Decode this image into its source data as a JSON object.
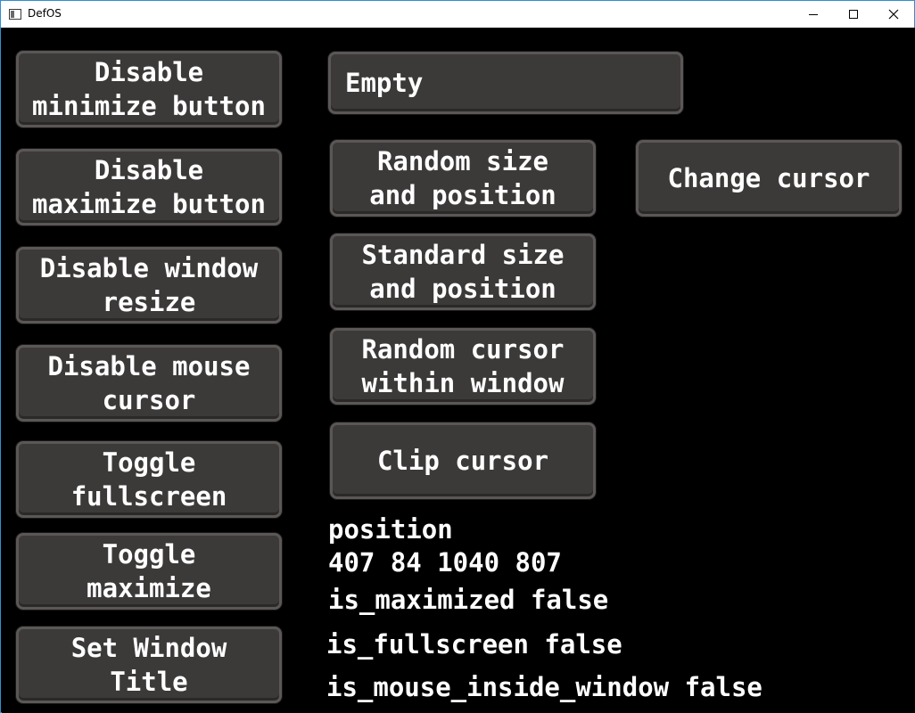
{
  "window": {
    "title": "DefOS",
    "icons": {
      "app": "window-icon",
      "minimize": "minimize-icon",
      "maximize": "maximize-icon",
      "close": "close-icon"
    },
    "colors": {
      "frame": "#2f8fcf",
      "background": "#000000",
      "button_fill": "#3c3a39",
      "button_border": "#5a5756",
      "text": "#ffffff"
    }
  },
  "buttons": {
    "disable_minimize": "Disable\nminimize button",
    "disable_maximize": "Disable\nmaximize button",
    "disable_resize": "Disable window\nresize",
    "disable_mouse_cursor": "Disable mouse\ncursor",
    "toggle_fullscreen": "Toggle\nfullscreen",
    "toggle_maximize": "Toggle\nmaximize",
    "set_window_title": "Set Window\nTitle",
    "empty": "Empty",
    "random_size_position": "Random size\nand position",
    "standard_size_position": "Standard size\nand position",
    "random_cursor": "Random cursor\nwithin window",
    "clip_cursor": "Clip cursor",
    "change_cursor": "Change cursor"
  },
  "info": {
    "position_label": "position",
    "position_value": "407 84 1040 807",
    "is_maximized": "is_maximized false",
    "is_fullscreen": "is_fullscreen false",
    "is_mouse_inside_window": "is_mouse_inside_window false"
  }
}
